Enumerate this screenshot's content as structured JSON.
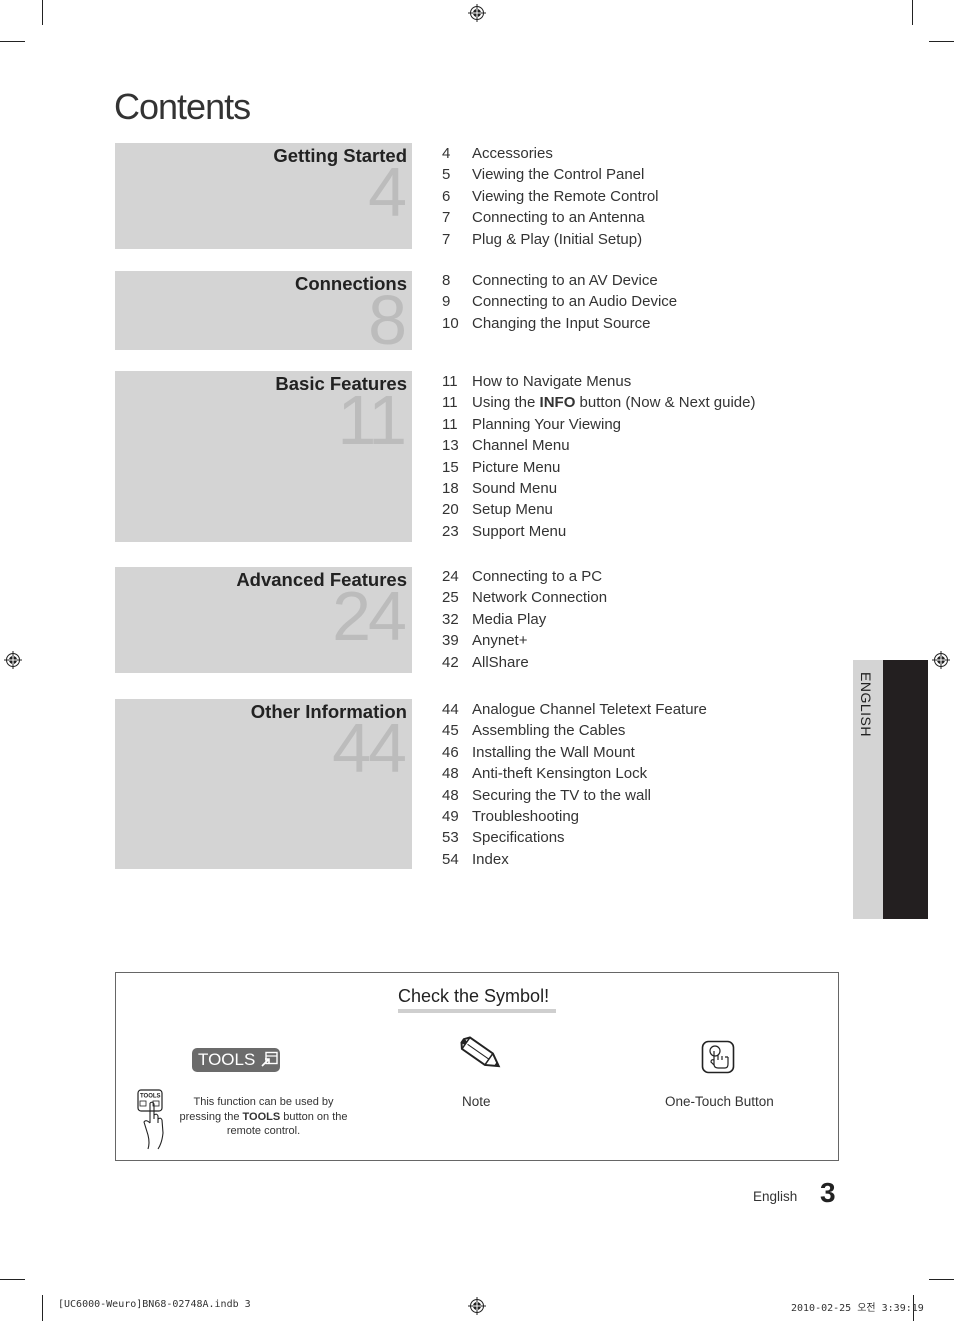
{
  "page_title": "Contents",
  "sections": [
    {
      "name": "Getting Started",
      "start_page": "4",
      "entries": [
        {
          "page": "4",
          "title": "Accessories"
        },
        {
          "page": "5",
          "title": "Viewing the Control Panel"
        },
        {
          "page": "6",
          "title": "Viewing the Remote Control"
        },
        {
          "page": "7",
          "title": "Connecting to an Antenna"
        },
        {
          "page": "7",
          "title": "Plug & Play (Initial Setup)"
        }
      ]
    },
    {
      "name": "Connections",
      "start_page": "8",
      "entries": [
        {
          "page": "8",
          "title": "Connecting to an AV Device"
        },
        {
          "page": "9",
          "title": "Connecting to an Audio Device"
        },
        {
          "page": "10",
          "title": "Changing the Input Source"
        }
      ]
    },
    {
      "name": "Basic Features",
      "start_page": "11",
      "entries": [
        {
          "page": "11",
          "title": "How to Navigate Menus"
        },
        {
          "page": "11",
          "title_pre": "Using the ",
          "title_bold": "INFO",
          "title_post": " button (Now & Next guide)"
        },
        {
          "page": "11",
          "title": "Planning Your Viewing"
        },
        {
          "page": "13",
          "title": "Channel Menu"
        },
        {
          "page": "15",
          "title": "Picture Menu"
        },
        {
          "page": "18",
          "title": "Sound Menu"
        },
        {
          "page": "20",
          "title": "Setup Menu"
        },
        {
          "page": "23",
          "title": "Support Menu"
        }
      ]
    },
    {
      "name": "Advanced Features",
      "start_page": "24",
      "entries": [
        {
          "page": "24",
          "title": "Connecting to a PC"
        },
        {
          "page": "25",
          "title": "Network Connection"
        },
        {
          "page": "32",
          "title": "Media Play"
        },
        {
          "page": "39",
          "title": "Anynet+"
        },
        {
          "page": "42",
          "title": "AllShare"
        }
      ]
    },
    {
      "name": "Other Information",
      "start_page": "44",
      "entries": [
        {
          "page": "44",
          "title": "Analogue Channel Teletext Feature"
        },
        {
          "page": "45",
          "title": "Assembling the Cables"
        },
        {
          "page": "46",
          "title": "Installing the Wall Mount"
        },
        {
          "page": "48",
          "title": "Anti-theft Kensington Lock"
        },
        {
          "page": "48",
          "title": "Securing the TV to the wall"
        },
        {
          "page": "49",
          "title": "Troubleshooting"
        },
        {
          "page": "53",
          "title": "Specifications"
        },
        {
          "page": "54",
          "title": "Index"
        }
      ]
    }
  ],
  "language_tab": "ENGLISH",
  "symbols": {
    "title": "Check the Symbol!",
    "tools_badge": "TOOLS",
    "tools_remote_label": "TOOLS",
    "tools_desc_pre": "This function can be used by pressing the ",
    "tools_desc_bold": "TOOLS",
    "tools_desc_post": " button on the remote control.",
    "note_label": "Note",
    "onetouch_label": "One-Touch Button"
  },
  "footer": {
    "language": "English",
    "page_number": "3"
  },
  "slug": {
    "file": "[UC6000-Weuro]BN68-02748A.indb   3",
    "datetime": "2010-02-25   오전 3:39:19"
  },
  "colors": {
    "section_bg": "#d4d4d4",
    "section_number": "#bcbcbc",
    "tab_dark": "#231f20",
    "badge_bg": "#6b6b6b"
  }
}
